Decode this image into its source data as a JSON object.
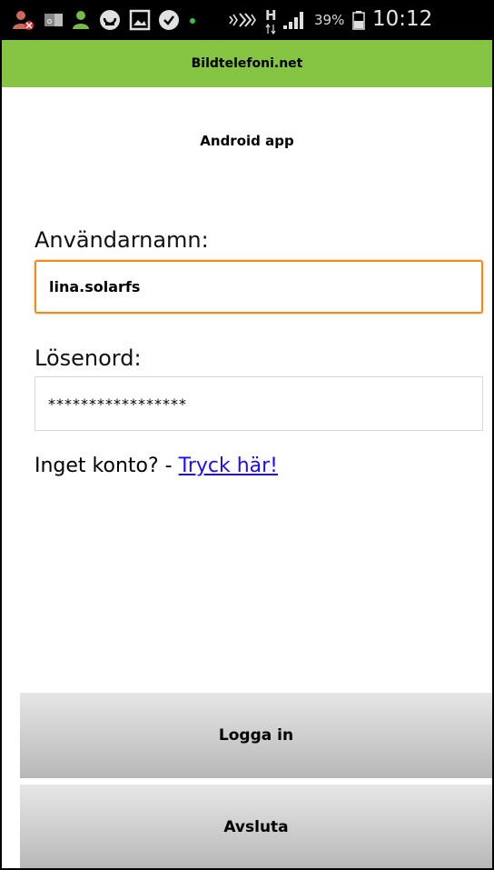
{
  "status_bar": {
    "battery_percent": "39%",
    "time": "10:12",
    "network_type": "H",
    "icons": [
      "contact-blocked-icon",
      "outlook-icon",
      "contact-icon",
      "podcast-icon",
      "gallery-icon",
      "checkmark-icon",
      "notification-dot-icon",
      "nfc-vibrate-icon",
      "signal-icon",
      "battery-icon"
    ]
  },
  "app": {
    "title": "Bildtelefoni.net",
    "subtitle": "Android app",
    "accent_color": "#86c543",
    "focus_color": "#f08a1c"
  },
  "form": {
    "username_label": "Användarnamn:",
    "username_value": "lina.solarfs",
    "password_label": "Lösenord:",
    "password_value": "*****************"
  },
  "signup": {
    "text": "Inget konto? - ",
    "link_text": "Tryck här!",
    "link_color": "#1a0dff"
  },
  "buttons": {
    "login": "Logga in",
    "exit": "Avsluta"
  }
}
